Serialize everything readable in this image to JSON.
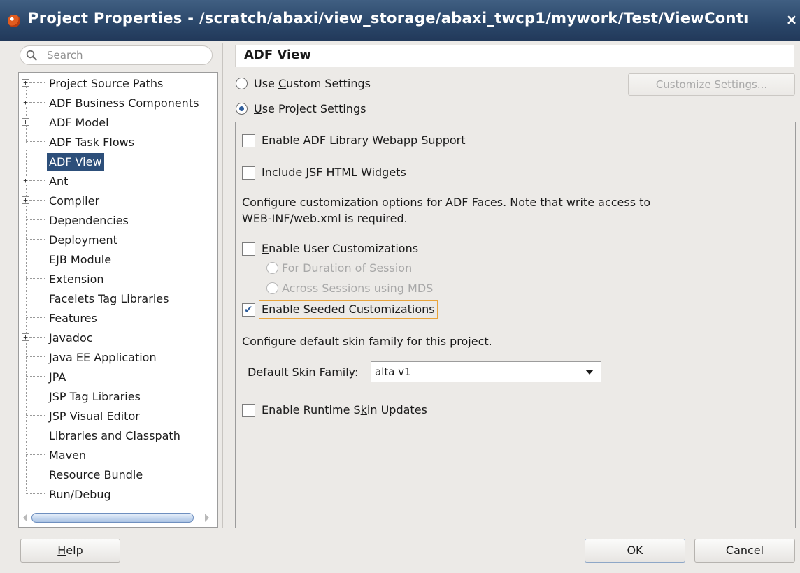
{
  "window": {
    "title": "Project Properties - /scratch/abaxi/view_storage/abaxi_twcp1/mywork/Test/ViewContı",
    "close_glyph": "×"
  },
  "search": {
    "placeholder": "Search",
    "value": ""
  },
  "tree": {
    "items": [
      {
        "label": "Project Source Paths",
        "expandable": true,
        "selected": false
      },
      {
        "label": "ADF Business Components",
        "expandable": true,
        "selected": false
      },
      {
        "label": "ADF Model",
        "expandable": true,
        "selected": false
      },
      {
        "label": "ADF Task Flows",
        "expandable": false,
        "selected": false
      },
      {
        "label": "ADF View",
        "expandable": false,
        "selected": true
      },
      {
        "label": "Ant",
        "expandable": true,
        "selected": false
      },
      {
        "label": "Compiler",
        "expandable": true,
        "selected": false
      },
      {
        "label": "Dependencies",
        "expandable": false,
        "selected": false
      },
      {
        "label": "Deployment",
        "expandable": false,
        "selected": false
      },
      {
        "label": "EJB Module",
        "expandable": false,
        "selected": false
      },
      {
        "label": "Extension",
        "expandable": false,
        "selected": false
      },
      {
        "label": "Facelets Tag Libraries",
        "expandable": false,
        "selected": false
      },
      {
        "label": "Features",
        "expandable": false,
        "selected": false
      },
      {
        "label": "Javadoc",
        "expandable": true,
        "selected": false
      },
      {
        "label": "Java EE Application",
        "expandable": false,
        "selected": false
      },
      {
        "label": "JPA",
        "expandable": false,
        "selected": false
      },
      {
        "label": "JSP Tag Libraries",
        "expandable": false,
        "selected": false
      },
      {
        "label": "JSP Visual Editor",
        "expandable": false,
        "selected": false
      },
      {
        "label": "Libraries and Classpath",
        "expandable": false,
        "selected": false
      },
      {
        "label": "Maven",
        "expandable": false,
        "selected": false
      },
      {
        "label": "Resource Bundle",
        "expandable": false,
        "selected": false
      },
      {
        "label": "Run/Debug",
        "expandable": false,
        "selected": false
      }
    ],
    "expand_glyph": "+"
  },
  "section": {
    "title": "ADF View"
  },
  "settings_mode": {
    "custom": {
      "pre": "Use ",
      "mn": "C",
      "post": "ustom Settings",
      "checked": false
    },
    "project": {
      "pre": "",
      "mn": "U",
      "post": "se Project Settings",
      "checked": true
    }
  },
  "customize_button": {
    "pre": "Customi",
    "mn": "z",
    "post": "e Settings..."
  },
  "options": {
    "library_webapp": {
      "pre": "Enable ADF ",
      "mn": "L",
      "post": "ibrary Webapp Support",
      "checked": false
    },
    "jsf_widgets": {
      "pre": "Include ",
      "mn": "J",
      "post": "SF HTML Widgets",
      "checked": false
    },
    "customization_desc_1": "Configure customization options for ADF Faces. Note that write access to",
    "customization_desc_2": "WEB-INF/web.xml is required.",
    "user_customizations": {
      "pre": "",
      "mn": "E",
      "post": "nable User Customizations",
      "checked": false
    },
    "duration_session": {
      "pre": "",
      "mn": "F",
      "post": "or Duration of Session",
      "checked": false
    },
    "across_sessions": {
      "pre": "",
      "mn": "A",
      "post": "cross Sessions using MDS",
      "checked": false
    },
    "seeded_customizations": {
      "pre": "Enable ",
      "mn": "S",
      "post": "eeded Customizations",
      "checked": true
    },
    "skin_desc": "Configure default skin family for this project.",
    "skin_label": {
      "pre": "",
      "mn": "D",
      "post": "efault Skin Family:"
    },
    "skin_value": "alta v1",
    "runtime_skin": {
      "pre": "Enable Runtime S",
      "mn": "k",
      "post": "in Updates",
      "checked": false
    },
    "check_glyph": "✔"
  },
  "footer": {
    "help": {
      "pre": "",
      "mn": "H",
      "post": "elp"
    },
    "ok": "OK",
    "cancel": "Cancel"
  },
  "colors": {
    "titlebar": "#2a4669",
    "selection": "#2d4f7a",
    "focus_ring": "#e9a43a",
    "check_accent": "#2f5e9c"
  }
}
